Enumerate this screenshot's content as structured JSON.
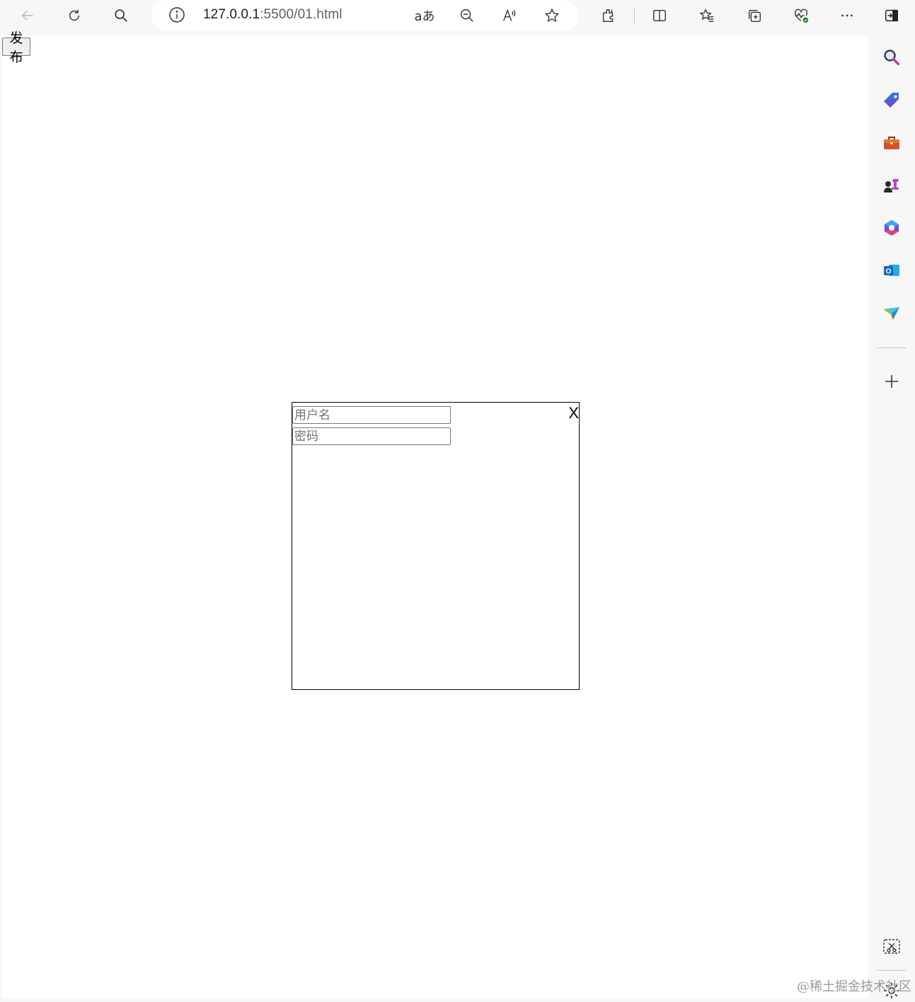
{
  "browser": {
    "url_host": "127.0.0.1",
    "url_path": ":5500/01.html",
    "read_aloud_label": "aあ"
  },
  "page": {
    "publish_button": "发布",
    "dialog": {
      "username_placeholder": "用户名",
      "password_placeholder": "密码",
      "close_label": "X"
    }
  },
  "watermark": "@稀土掘金技术社区"
}
